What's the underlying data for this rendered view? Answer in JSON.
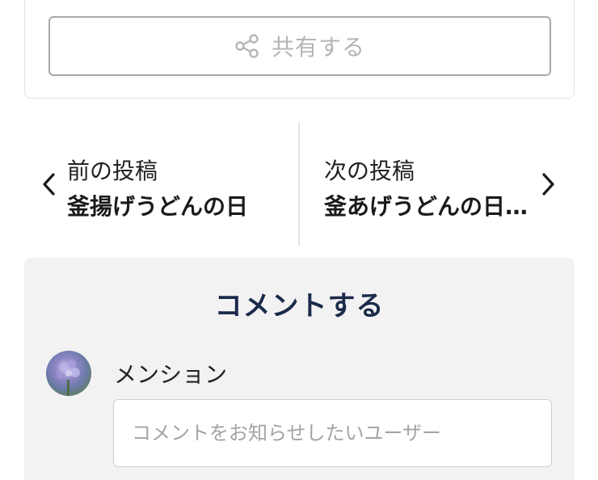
{
  "share": {
    "label": "共有する",
    "icon": "share-icon"
  },
  "post_nav": {
    "prev": {
      "label": "前の投稿",
      "title": "釜揚げうどんの日",
      "icon": "chevron-left-icon"
    },
    "next": {
      "label": "次の投稿",
      "title": "釜あげうどんの日…",
      "icon": "chevron-right-icon"
    }
  },
  "comment": {
    "heading": "コメントする",
    "mention_label": "メンション",
    "mention_placeholder": "コメントをお知らせしたいユーザー"
  },
  "colors": {
    "heading": "#1b2a4a",
    "section_bg": "#f3f2f3",
    "share_text": "#b5b5b5"
  }
}
